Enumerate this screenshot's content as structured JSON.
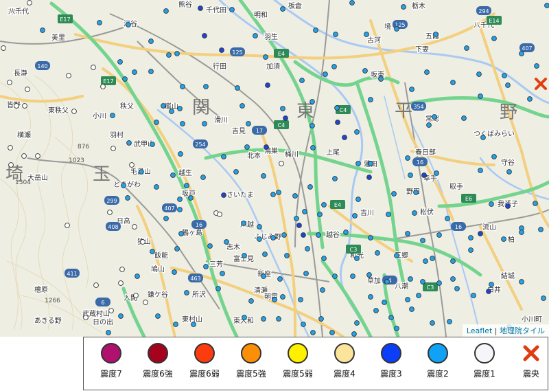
{
  "map": {
    "place_labels_large": [
      "関",
      "東",
      "平",
      "野",
      "玉",
      "埼"
    ],
    "place_labels": [
      "神川",
      "深谷",
      "熊谷",
      "行田",
      "羽生",
      "加須",
      "古河",
      "板倉",
      "栃木",
      "千代田",
      "明和",
      "美里",
      "長瀞",
      "皆野",
      "東秩父",
      "小川",
      "横瀬",
      "秩父",
      "嵐山",
      "滑川",
      "吉見",
      "鴻巣",
      "北本",
      "桶川",
      "上尾",
      "蓮田",
      "春日部",
      "幸手",
      "野田",
      "松伏",
      "吉川",
      "越谷",
      "さいたま",
      "川越",
      "ふじみ野",
      "富士見",
      "志木",
      "三芳",
      "所沢",
      "東村山",
      "東大和",
      "清瀬",
      "新座",
      "朝霞",
      "和光",
      "草加",
      "八潮",
      "三郷",
      "流山",
      "柏",
      "我孫子",
      "取手",
      "守谷",
      "つくばみらい",
      "常総",
      "坂東",
      "境",
      "五霞",
      "八千代",
      "下妻",
      "結城",
      "白井",
      "鎌ケ谷",
      "武蔵村山",
      "日の出",
      "あきる野",
      "檜原",
      "大岳山",
      "武甲山",
      "ときがわ",
      "毛呂山",
      "越生",
      "坂戸",
      "鶴ヶ島",
      "狭山",
      "飯能",
      "日高",
      "鳩山",
      "入間",
      "羽村",
      "小川町",
      "八千代"
    ],
    "road_shields": [
      "E17",
      "E17",
      "E4",
      "E4",
      "C4",
      "C4",
      "C3",
      "C3",
      "E6",
      "E14",
      "125",
      "125",
      "140",
      "299",
      "254",
      "407",
      "407",
      "16",
      "16",
      "16",
      "17",
      "354",
      "294",
      "408",
      "463",
      "411",
      "6",
      "4"
    ],
    "spot_heights": [
      "1304",
      "876",
      "1266",
      "1023"
    ],
    "attribution_prefix": "Leaflet",
    "attribution_sep": " | ",
    "attribution_text": "地理院タイル"
  },
  "legend": {
    "items": [
      {
        "label": "震度7",
        "color": "#b0106e"
      },
      {
        "label": "震度6強",
        "color": "#a5021e"
      },
      {
        "label": "震度6弱",
        "color": "#fc3b0e"
      },
      {
        "label": "震度5強",
        "color": "#fb9008"
      },
      {
        "label": "震度5弱",
        "color": "#fff000"
      },
      {
        "label": "震度4",
        "color": "#fbe49c"
      },
      {
        "label": "震度3",
        "color": "#0a3ef8"
      },
      {
        "label": "震度2",
        "color": "#10a2f6"
      },
      {
        "label": "震度1",
        "color": "#f5f5fa"
      },
      {
        "label": "震央",
        "color": "#e03c10",
        "icon": "epicenter-x-icon"
      }
    ]
  },
  "colors": {
    "intensity_3": "#1f44d8",
    "intensity_2": "#21a3ec",
    "intensity_1": "#ffffff",
    "epicenter": "#e04010",
    "expressway": "#74d48e",
    "national_road": "#f3cf7e",
    "railway": "#9a9a9a",
    "river": "#a9c9f5",
    "land": "#eeeee2"
  }
}
